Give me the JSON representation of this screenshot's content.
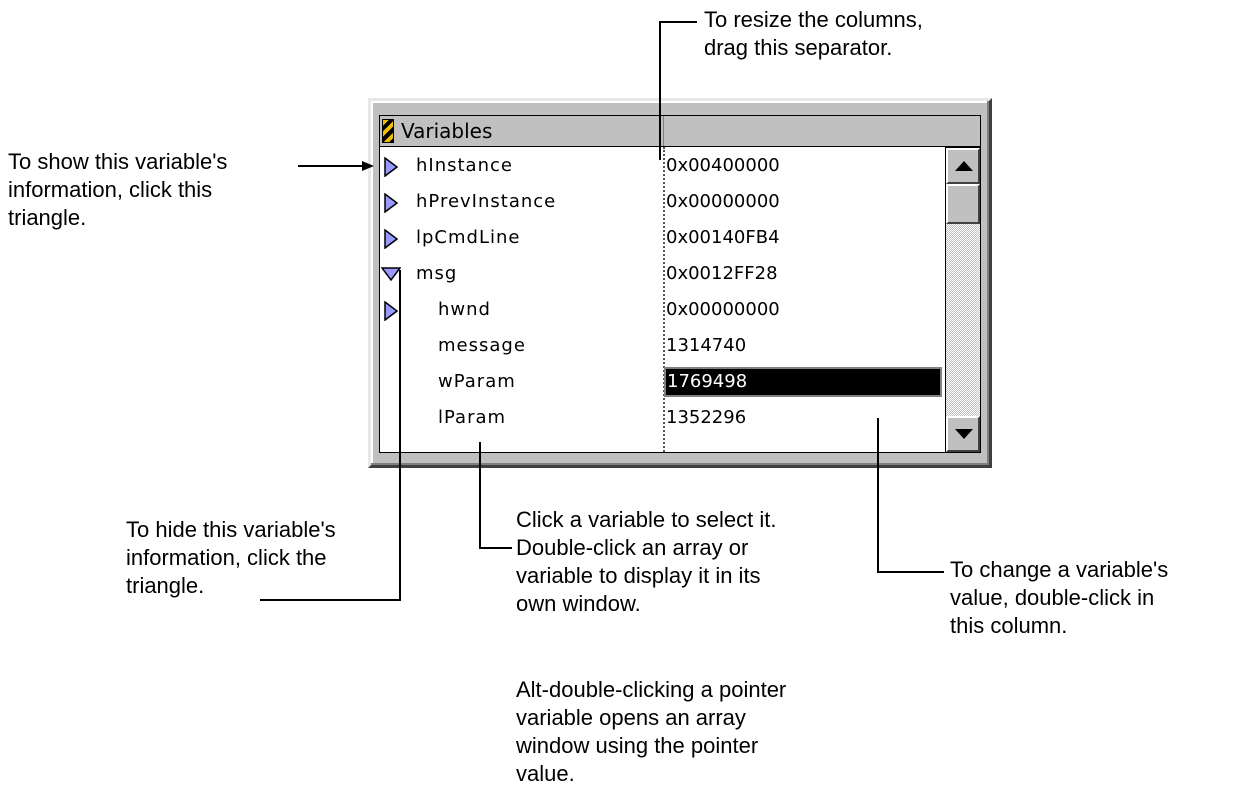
{
  "window": {
    "title": "Variables",
    "variables": [
      {
        "name": "hInstance",
        "value": "0x00400000",
        "expander": "collapsed"
      },
      {
        "name": "hPrevInstance",
        "value": "0x00000000",
        "expander": "collapsed"
      },
      {
        "name": "lpCmdLine",
        "value": "0x00140FB4",
        "expander": "collapsed"
      },
      {
        "name": "msg",
        "value": "0x0012FF28",
        "expander": "expanded"
      },
      {
        "name": "hwnd",
        "value": "0x00000000",
        "expander": "collapsed"
      },
      {
        "name": "message",
        "value": "1314740",
        "expander": "none"
      },
      {
        "name": "wParam",
        "value": "1769498",
        "expander": "none",
        "selected": true
      },
      {
        "name": "lParam",
        "value": "1352296",
        "expander": "none"
      }
    ]
  },
  "callouts": {
    "resize": [
      "To resize the columns,",
      "drag this separator."
    ],
    "show": [
      "To show this variable's",
      "information, click this",
      "triangle."
    ],
    "hide": [
      "To hide this variable's",
      "information, click the",
      "triangle."
    ],
    "select": [
      "Click a variable to select it.",
      "Double-click an array or",
      "variable to display it in its",
      "own window."
    ],
    "alt": [
      "Alt-double-clicking a pointer",
      "variable opens an array",
      "window using the pointer",
      "value."
    ],
    "change": [
      "To change a variable's",
      "value, double-click in",
      "this column."
    ]
  },
  "icons": {
    "expand": "right-triangle-icon",
    "collapse": "down-triangle-icon",
    "scroll_up": "up-arrow-icon",
    "scroll_down": "down-arrow-icon"
  },
  "colors": {
    "triangle_fill": "#9999ff",
    "window_face": "#c0c0c0",
    "selection": "#000000"
  }
}
